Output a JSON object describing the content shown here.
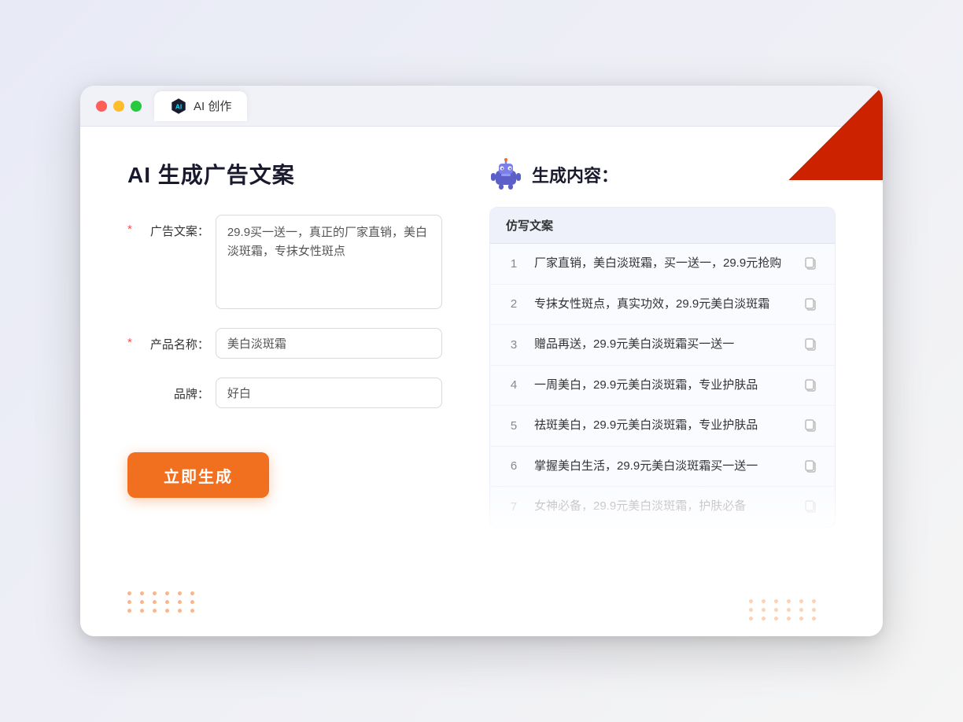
{
  "window": {
    "tab_label": "AI 创作"
  },
  "page": {
    "title": "AI 生成广告文案",
    "generate_button": "立即生成"
  },
  "form": {
    "ad_copy_label": "广告文案：",
    "ad_copy_required": "*",
    "ad_copy_value": "29.9买一送一，真正的厂家直销，美白淡斑霜，专抹女性斑点",
    "product_name_label": "产品名称：",
    "product_name_required": "*",
    "product_name_value": "美白淡斑霜",
    "brand_label": "品牌：",
    "brand_value": "好白"
  },
  "results": {
    "header_icon": "robot",
    "header_title": "生成内容：",
    "table_header": "仿写文案",
    "items": [
      {
        "number": "1",
        "text": "厂家直销，美白淡斑霜，买一送一，29.9元抢购",
        "faded": false
      },
      {
        "number": "2",
        "text": "专抹女性斑点，真实功效，29.9元美白淡斑霜",
        "faded": false
      },
      {
        "number": "3",
        "text": "赠品再送，29.9元美白淡斑霜买一送一",
        "faded": false
      },
      {
        "number": "4",
        "text": "一周美白，29.9元美白淡斑霜，专业护肤品",
        "faded": false
      },
      {
        "number": "5",
        "text": "祛斑美白，29.9元美白淡斑霜，专业护肤品",
        "faded": false
      },
      {
        "number": "6",
        "text": "掌握美白生活，29.9元美白淡斑霜买一送一",
        "faded": false
      },
      {
        "number": "7",
        "text": "女神必备，29.9元美白淡斑霜，护肤必备",
        "faded": true
      }
    ]
  }
}
